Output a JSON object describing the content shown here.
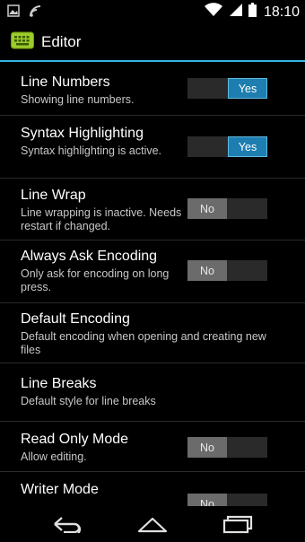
{
  "status_bar": {
    "time": "18:10",
    "left_icons": [
      "image-icon",
      "wifi-alt-icon"
    ],
    "right_icons": [
      "wifi-icon",
      "signal-icon",
      "battery-icon"
    ]
  },
  "action_bar": {
    "app_icon": "keyboard-icon",
    "title": "Editor",
    "accent": "#33b5e5"
  },
  "settings": [
    {
      "title": "Line Numbers",
      "summary": "Showing line numbers.",
      "toggle": true,
      "value": "Yes"
    },
    {
      "title": "Syntax Highlighting",
      "summary": "Syntax highlighting is active.",
      "toggle": true,
      "value": "Yes"
    },
    {
      "title": "Line Wrap",
      "summary": "Line wrapping is inactive. Needs restart if changed.",
      "toggle": true,
      "value": "No"
    },
    {
      "title": "Always Ask Encoding",
      "summary": "Only ask for encoding on long press.",
      "toggle": true,
      "value": "No"
    },
    {
      "title": "Default Encoding",
      "summary": "Default encoding when opening and creating new files",
      "toggle": false,
      "value": null
    },
    {
      "title": "Line Breaks",
      "summary": "Default style for line breaks",
      "toggle": false,
      "value": null
    },
    {
      "title": "Read Only Mode",
      "summary": "Allow editing.",
      "toggle": true,
      "value": "No"
    },
    {
      "title": "Writer Mode",
      "summary": "",
      "toggle": true,
      "value": "No"
    }
  ],
  "nav_bar": {
    "buttons": [
      "back-icon",
      "home-icon",
      "recent-apps-icon"
    ]
  },
  "colors": {
    "toggle_on": "#1e7eb0",
    "toggle_off": "#6b6b6b"
  }
}
